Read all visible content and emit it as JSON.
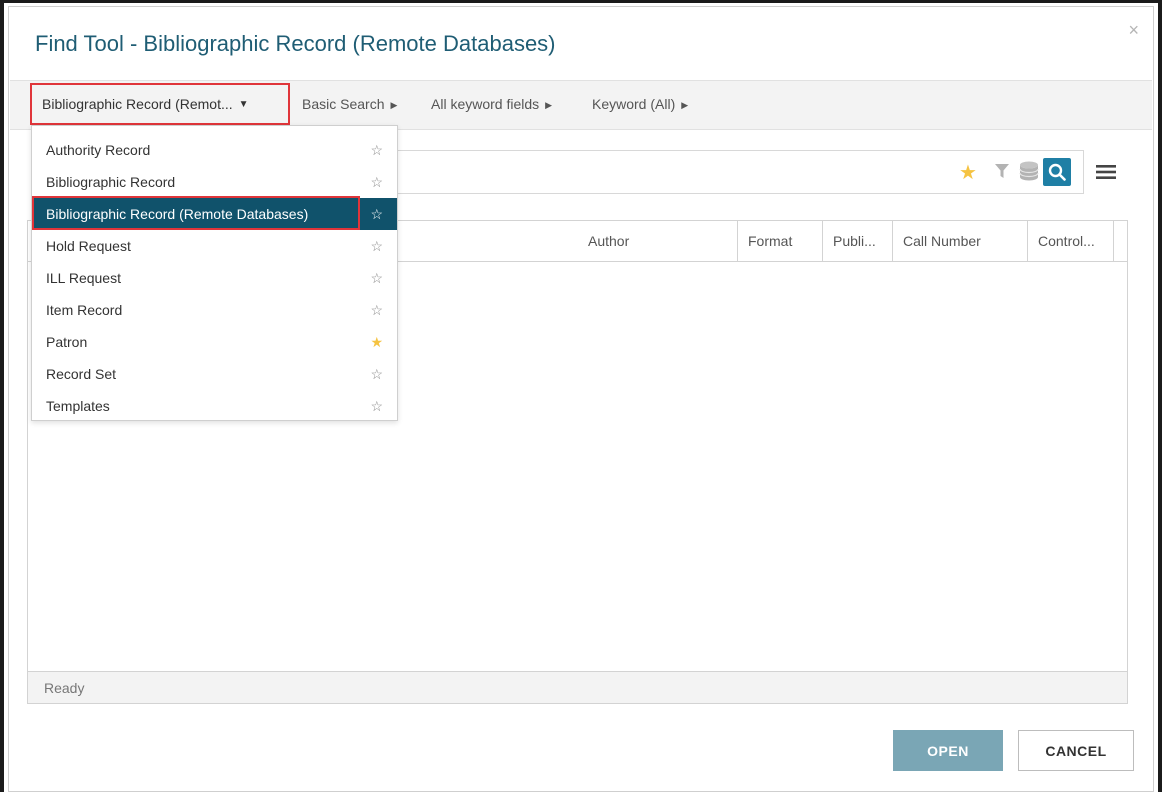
{
  "dialog": {
    "title": "Find Tool - Bibliographic Record (Remote Databases)",
    "close_label": "×"
  },
  "crumbs": {
    "record_type": "Bibliographic Record (Remot...",
    "record_caret": "▼",
    "search_mode": "Basic Search",
    "field": "All keyword fields",
    "qualifier": "Keyword (All)",
    "arrow": "▶"
  },
  "search": {
    "placeholder": "",
    "icons": [
      "star-icon",
      "filter-icon",
      "database-icon",
      "search-icon",
      "hamburger-menu-icon"
    ]
  },
  "grid": {
    "columns": [
      "Author",
      "Format",
      "Publi...",
      "Call Number",
      "Control..."
    ],
    "status": "Ready"
  },
  "dropdown": {
    "items": [
      {
        "label": "Authority Record",
        "favorite": false
      },
      {
        "label": "Bibliographic Record",
        "favorite": false
      },
      {
        "label": "Bibliographic Record (Remote Databases)",
        "favorite": false,
        "selected": true
      },
      {
        "label": "Hold Request",
        "favorite": false
      },
      {
        "label": "ILL Request",
        "favorite": false
      },
      {
        "label": "Item Record",
        "favorite": false
      },
      {
        "label": "Patron",
        "favorite": true
      },
      {
        "label": "Record Set",
        "favorite": false
      },
      {
        "label": "Templates",
        "favorite": false
      }
    ],
    "star_empty": "☆",
    "star_filled": "★"
  },
  "buttons": {
    "open": "OPEN",
    "cancel": "CANCEL"
  },
  "colors": {
    "accent": "#1f7fa5",
    "selected_bg": "#10526b",
    "highlight_outline": "#e0353a",
    "favorite_star": "#f5c342",
    "title": "#1f5d74"
  }
}
